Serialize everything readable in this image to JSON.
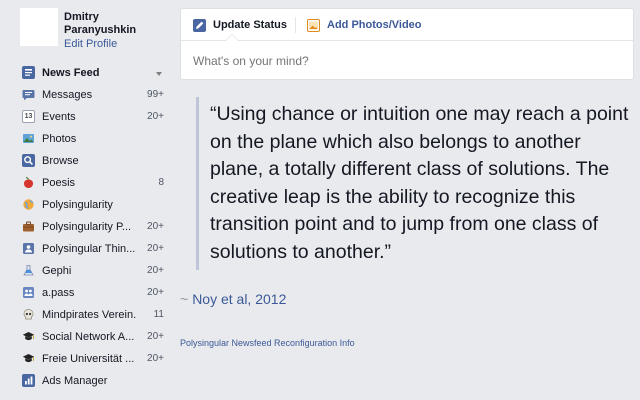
{
  "profile": {
    "name": "Dmitry Paranyushkin",
    "edit_label": "Edit Profile"
  },
  "sidebar": {
    "items": [
      {
        "label": "News Feed",
        "count": "",
        "icon": "news-feed-icon",
        "active": true
      },
      {
        "label": "Messages",
        "count": "99+",
        "icon": "messages-icon"
      },
      {
        "label": "Events",
        "count": "20+",
        "icon": "calendar-icon",
        "icon_text": "13"
      },
      {
        "label": "Photos",
        "count": "",
        "icon": "photos-icon"
      },
      {
        "label": "Browse",
        "count": "",
        "icon": "search-icon"
      },
      {
        "label": "Poesis",
        "count": "8",
        "icon": "poesis-icon"
      },
      {
        "label": "Polysingularity",
        "count": "",
        "icon": "globe-icon"
      },
      {
        "label": "Polysingularity P...",
        "count": "20+",
        "icon": "briefcase-icon"
      },
      {
        "label": "Polysingular Thin...",
        "count": "20+",
        "icon": "group-icon"
      },
      {
        "label": "Gephi",
        "count": "20+",
        "icon": "flask-icon"
      },
      {
        "label": "a.pass",
        "count": "20+",
        "icon": "people-icon"
      },
      {
        "label": "Mindpirates Verein...",
        "count": "11",
        "icon": "skull-icon"
      },
      {
        "label": "Social Network A...",
        "count": "20+",
        "icon": "graduation-cap-icon"
      },
      {
        "label": "Freie Universität ...",
        "count": "20+",
        "icon": "graduation-cap-icon"
      },
      {
        "label": "Ads Manager",
        "count": "",
        "icon": "bar-chart-icon"
      }
    ]
  },
  "composer": {
    "tab_status": "Update Status",
    "tab_photos": "Add Photos/Video",
    "placeholder": "What's on your mind?"
  },
  "quote": {
    "text": "“Using chance or intuition one may reach a point on the plane which also belongs to another plane, a totally different class of solutions. The creative leap is the ability to recognize this transition point and to jump from one class of solutions to another.”",
    "tilde": "~",
    "attribution": "Noy et al, 2012"
  },
  "footer": {
    "link": "Polysingular Newsfeed Reconfiguration Info"
  },
  "colors": {
    "link": "#3b5998",
    "background": "#e9eaed",
    "quote_bar": "#bfc4d9"
  }
}
